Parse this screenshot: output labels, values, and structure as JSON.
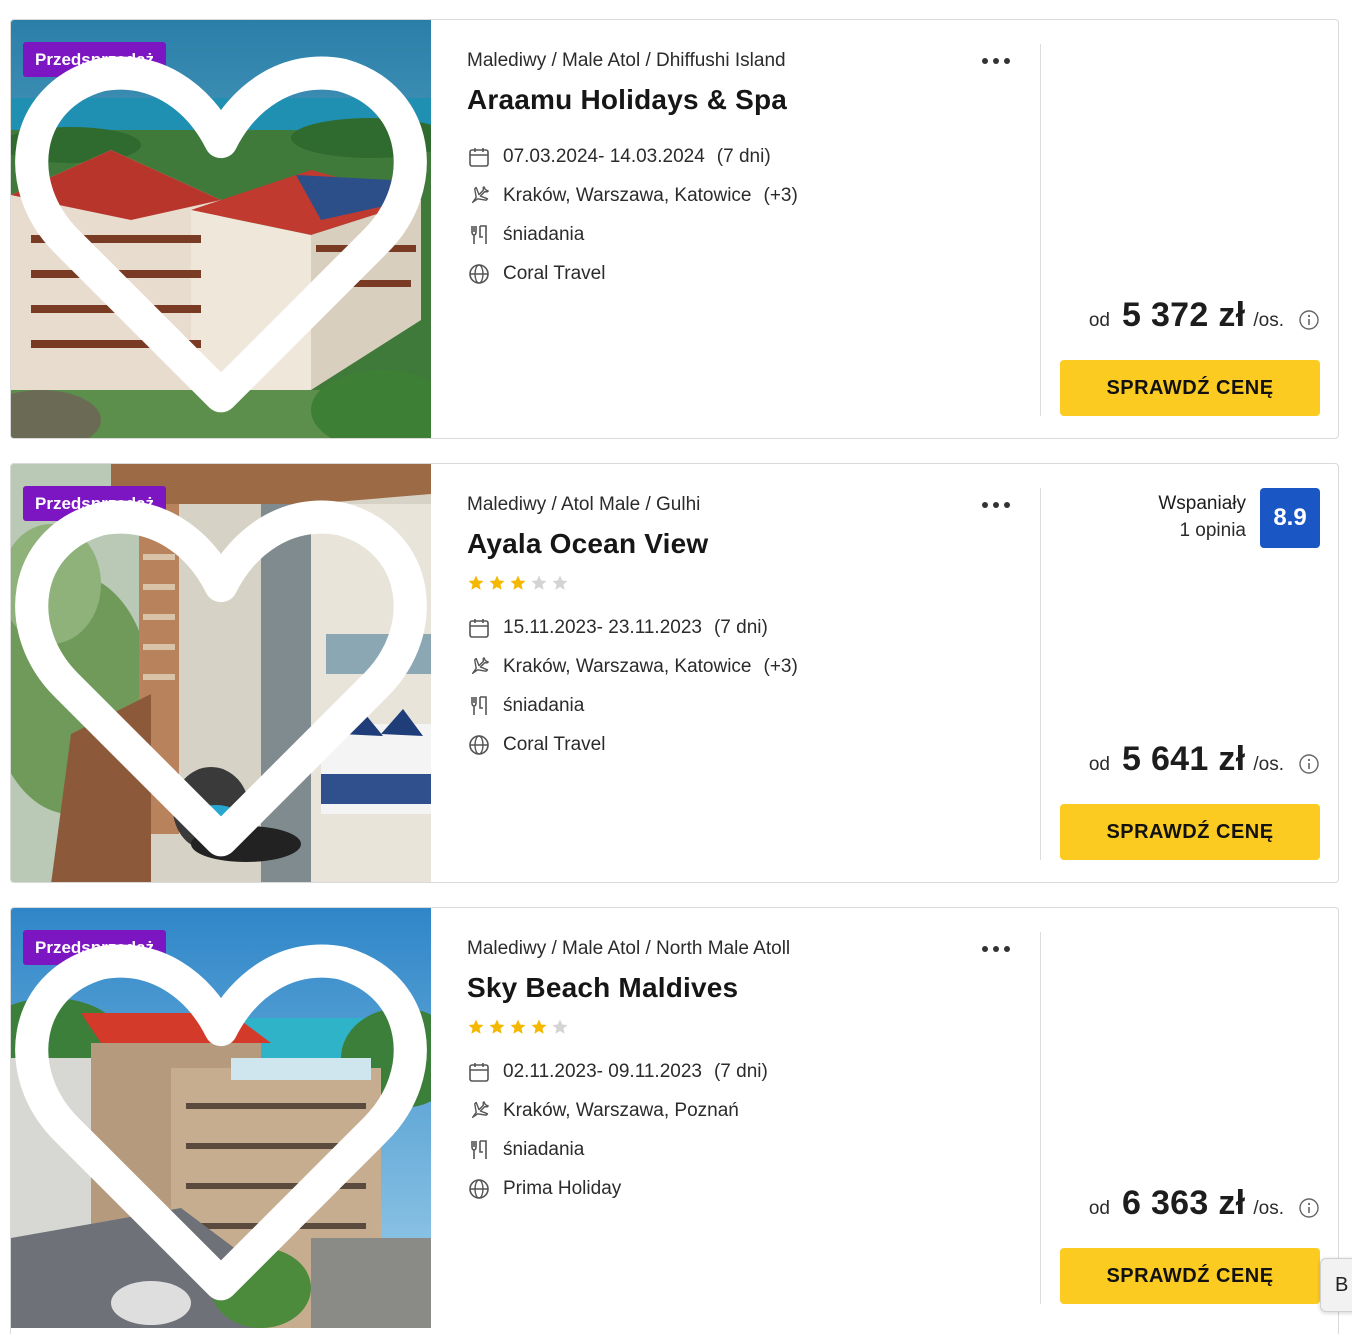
{
  "offers": [
    {
      "badge": "Przedsprzedaż",
      "breadcrumb": "Malediwy / Male Atol / Dhiffushi Island",
      "name": "Araamu Holidays & Spa",
      "stars": 0,
      "dates": "07.03.2024- 14.03.2024",
      "duration": "(7 dni)",
      "departure": "Kraków, Warszawa, Katowice",
      "departure_extra": "(+3)",
      "board": "śniadania",
      "operator": "Coral Travel",
      "rating_label": "",
      "rating_count": "",
      "rating_score": "",
      "price_prefix": "od",
      "price": "5 372 zł",
      "price_suffix": "/os.",
      "cta": "SPRAWDŹ CENĘ"
    },
    {
      "badge": "Przedsprzedaż",
      "breadcrumb": "Malediwy / Atol Male / Gulhi",
      "name": "Ayala Ocean View",
      "stars": 3,
      "dates": "15.11.2023- 23.11.2023",
      "duration": "(7 dni)",
      "departure": "Kraków, Warszawa, Katowice",
      "departure_extra": "(+3)",
      "board": "śniadania",
      "operator": "Coral Travel",
      "rating_label": "Wspaniały",
      "rating_count": "1 opinia",
      "rating_score": "8.9",
      "price_prefix": "od",
      "price": "5 641 zł",
      "price_suffix": "/os.",
      "cta": "SPRAWDŹ CENĘ"
    },
    {
      "badge": "Przedsprzedaż",
      "breadcrumb": "Malediwy / Male Atol / North Male Atoll",
      "name": "Sky Beach Maldives",
      "stars": 4,
      "dates": "02.11.2023- 09.11.2023",
      "duration": "(7 dni)",
      "departure": "Kraków, Warszawa, Poznań",
      "departure_extra": "",
      "board": "śniadania",
      "operator": "Prima Holiday",
      "rating_label": "",
      "rating_count": "",
      "rating_score": "",
      "price_prefix": "od",
      "price": "6 363 zł",
      "price_suffix": "/os.",
      "cta": "SPRAWDŹ CENĘ"
    }
  ],
  "max_stars": 5,
  "icons": {
    "favorite": "heart-outline-icon",
    "menu": "more-dots-icon",
    "dates": "calendar-icon",
    "departure": "airplane-icon",
    "board": "cutlery-icon",
    "operator": "globe-icon",
    "price_info": "info-circle-icon"
  },
  "colors": {
    "badge": "#7b16c2",
    "cta": "#fccb22",
    "rating": "#1a56c4",
    "star_filled": "#f5b800",
    "star_empty": "#d4d4d4"
  },
  "side_tab": {
    "label": "B"
  }
}
